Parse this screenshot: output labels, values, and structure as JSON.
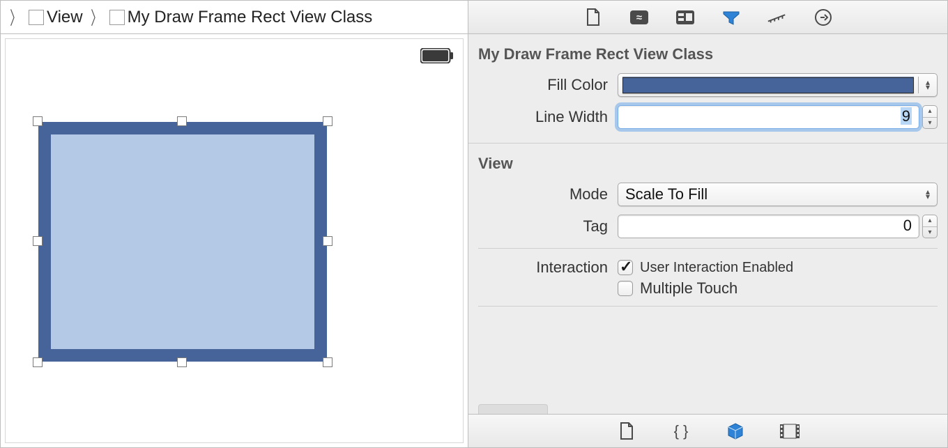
{
  "breadcrumb": {
    "item1": "View",
    "item2": "My Draw Frame Rect View Class"
  },
  "canvas": {
    "rect_fill_color": "#b3c9e6",
    "rect_border_color": "#46639a"
  },
  "inspector": {
    "custom": {
      "title": "My Draw Frame Rect View Class",
      "fill_color_label": "Fill Color",
      "fill_color_value": "#46639a",
      "line_width_label": "Line Width",
      "line_width_value": "9"
    },
    "view": {
      "title": "View",
      "mode_label": "Mode",
      "mode_value": "Scale To Fill",
      "tag_label": "Tag",
      "tag_value": "0",
      "interaction_label": "Interaction",
      "user_interaction_label": "User Interaction Enabled",
      "user_interaction_checked": true,
      "multiple_touch_label": "Multiple Touch",
      "multiple_touch_checked": false
    }
  },
  "top_tabs": [
    "file-icon",
    "quickhelp-icon",
    "identity-icon",
    "attributes-icon",
    "size-icon",
    "connections-icon"
  ],
  "bottom_tabs": [
    "file-template-icon",
    "snippets-icon",
    "object-library-icon",
    "media-icon"
  ]
}
